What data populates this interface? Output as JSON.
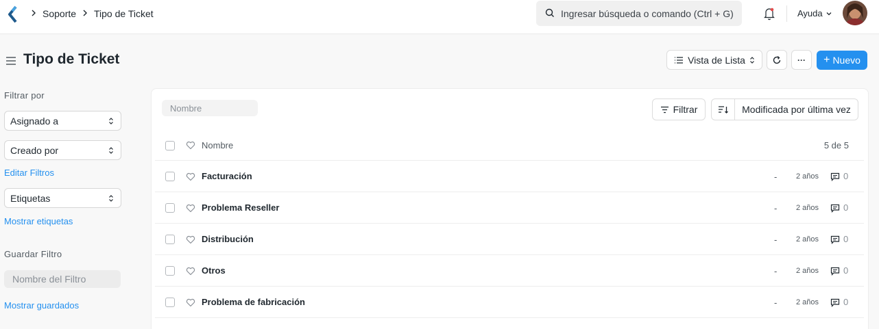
{
  "navbar": {
    "breadcrumbs": [
      "Soporte",
      "Tipo de Ticket"
    ],
    "search_placeholder": "Ingresar búsqueda o comando (Ctrl + G)",
    "help_label": "Ayuda"
  },
  "page": {
    "title": "Tipo de Ticket",
    "view_label": "Vista de Lista",
    "more_label": "···",
    "new_label": "Nuevo"
  },
  "sidebar": {
    "filter_by_label": "Filtrar por",
    "assigned_to": "Asignado a",
    "created_by": "Creado por",
    "edit_filters": "Editar Filtros",
    "tags": "Etiquetas",
    "show_tags": "Mostrar etiquetas",
    "save_filter_label": "Guardar Filtro",
    "filter_name_placeholder": "Nombre del Filtro",
    "show_saved": "Mostrar guardados"
  },
  "list": {
    "name_placeholder": "Nombre",
    "filter_label": "Filtrar",
    "sort_label": "Modificada por última vez",
    "header_name": "Nombre",
    "count_label": "5 de 5",
    "rows": [
      {
        "name": "Facturación",
        "dash": "-",
        "ago": "2 años",
        "comments": "0"
      },
      {
        "name": "Problema Reseller",
        "dash": "-",
        "ago": "2 años",
        "comments": "0"
      },
      {
        "name": "Distribución",
        "dash": "-",
        "ago": "2 años",
        "comments": "0"
      },
      {
        "name": "Otros",
        "dash": "-",
        "ago": "2 años",
        "comments": "0"
      },
      {
        "name": "Problema de fabricación",
        "dash": "-",
        "ago": "2 años",
        "comments": "0"
      }
    ]
  },
  "colors": {
    "accent": "#2490ef",
    "logo": "#1e5a8c",
    "notification_dot": "#e24c4c"
  }
}
